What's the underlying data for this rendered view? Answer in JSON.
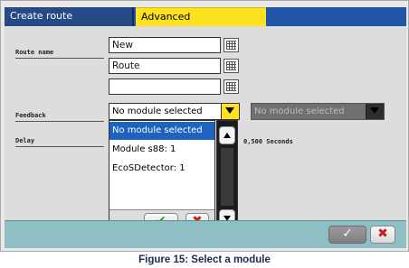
{
  "tabs": [
    {
      "label": "Create route",
      "active": false
    },
    {
      "label": "Advanced",
      "active": true
    }
  ],
  "form": {
    "route_name_label": "Route name",
    "name_lines": [
      "New",
      "Route",
      ""
    ],
    "feedback_label": "Feedback",
    "feedback_selected": "No module selected",
    "feedback_secondary": "No module selected",
    "delay_label": "Delay",
    "delay_value": "0,500 Seconds"
  },
  "dropdown": {
    "options": [
      "No module selected",
      "Module s88: 1",
      "EcoSDetector: 1"
    ],
    "selected_index": 0,
    "confirm_symbol": "✔",
    "cancel_symbol": "✖"
  },
  "footer": {
    "confirm_symbol": "✓",
    "cancel_symbol": "✖"
  },
  "caption": "Figure 15: Select a module",
  "colors": {
    "tab_active": "#ffe21f",
    "tab_inactive": "#274a86",
    "selection": "#1e63c0",
    "bottom_bar": "#8fbfc4"
  }
}
